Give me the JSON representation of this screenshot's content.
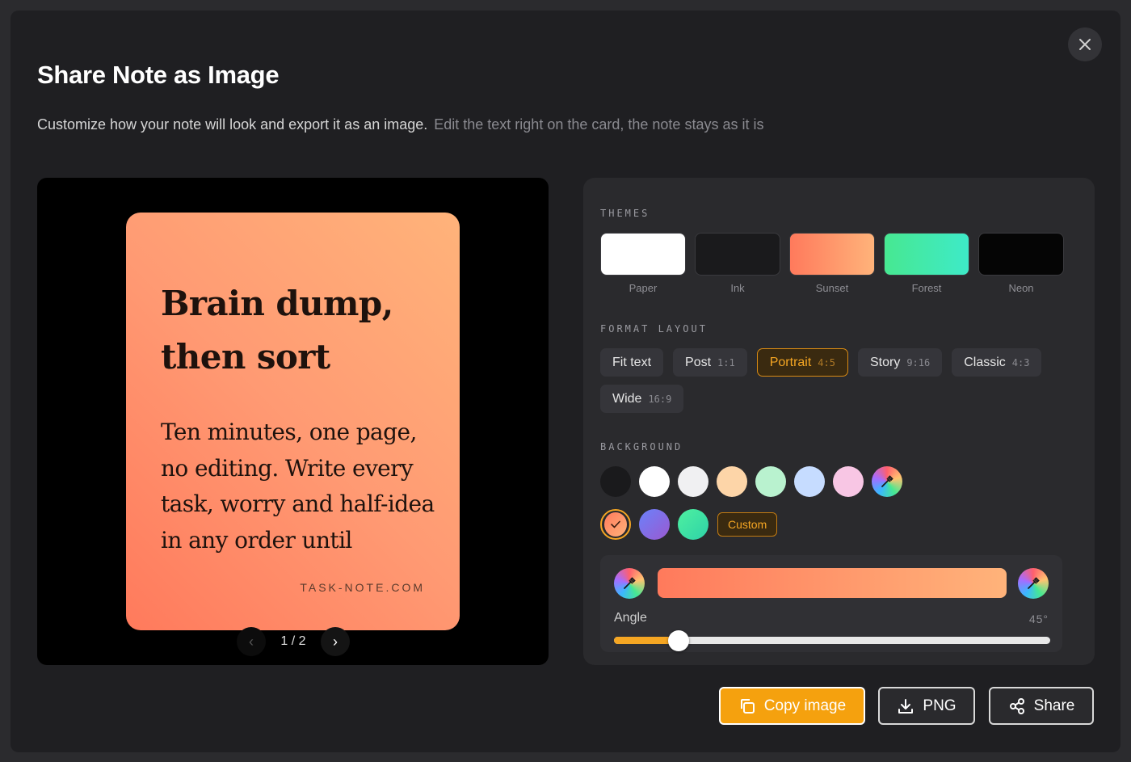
{
  "dialog": {
    "title": "Share Note as Image",
    "subtitle": "Customize how your note will look and export it as an image.",
    "subtitle_hint": "Edit the text right on the card, the note stays as it is",
    "close_icon": "close-icon"
  },
  "preview": {
    "card": {
      "title": "Brain dump, then sort",
      "body": "Ten minutes, one page, no editing. Write every task, worry and half-idea in any order until",
      "footer": "TASK-NOTE.COM"
    },
    "pager": {
      "text": "1 / 2",
      "prev": "‹",
      "next": "›",
      "prev_enabled": false,
      "next_enabled": true
    }
  },
  "themes": {
    "label": "THEMES",
    "items": [
      {
        "name": "Paper",
        "color": "#ffffff"
      },
      {
        "name": "Ink",
        "color": "#1a1a1c"
      },
      {
        "name": "Sunset",
        "color": "#ff9a73"
      },
      {
        "name": "Forest",
        "color": "#3ee9a0"
      },
      {
        "name": "Neon",
        "color": "#050505"
      }
    ]
  },
  "format": {
    "label": "FORMAT LAYOUT",
    "items": [
      {
        "label": "Fit text",
        "ratio": ""
      },
      {
        "label": "Post",
        "ratio": "1:1"
      },
      {
        "label": "Portrait",
        "ratio": "4:5",
        "active": true
      },
      {
        "label": "Story",
        "ratio": "9:16"
      },
      {
        "label": "Classic",
        "ratio": "4:3"
      },
      {
        "label": "Wide",
        "ratio": "16:9"
      }
    ]
  },
  "background": {
    "label": "BACKGROUND",
    "row1": [
      "#1a1a1c",
      "#ffffff",
      "#f0f0f2",
      "#fdd5a8",
      "#b9f2cf",
      "#c6dcff",
      "#f8c6e4"
    ],
    "row2": [
      "#ff8a6a",
      "#7b6be0",
      "#3fe49a"
    ],
    "selected": "#ff8a6a",
    "custom_label": "Custom",
    "picker_icon": "eyedropper-icon",
    "check_icon": "check-icon"
  },
  "gradient": {
    "start": "#ff7a5c",
    "end": "#ffb37a",
    "angle_label": "Angle",
    "angle_value": "45°",
    "angle_fraction": 0.14
  },
  "actions": {
    "copy": "Copy image",
    "png": "PNG",
    "share": "Share",
    "accent": "#f5a10e"
  }
}
